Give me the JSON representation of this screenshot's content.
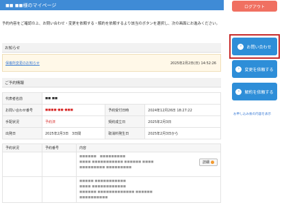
{
  "header": {
    "title": "◼◼ ◼◼様のマイページ"
  },
  "intro": "予約内容をご確認の上、お問い合わせ・変更を依頼する・解約を依頼するより該当のボタンを選択し、次の画面にお進みください。",
  "notice": {
    "heading": "お知らせ",
    "link": "保養所変更のお知らせ",
    "date": "2025年2月2日(日) 14:52:26"
  },
  "reservation": {
    "heading": "ご予約情報",
    "rows": [
      {
        "k1": "代表者名前",
        "v1": "◼◼ ◼◼",
        "k2": "",
        "v2": ""
      },
      {
        "k1": "お問い合わせ番号",
        "v1": "◼◼◼◼-◼◼-◼◼◼",
        "k2": "予約受付日時",
        "v2": "2024年12月26日 18:27:22"
      },
      {
        "k1": "手配状況",
        "v1": "予約済",
        "k2": "契約成立日",
        "v2": "2025年2月3日"
      },
      {
        "k1": "出発日",
        "v1": "2025年2月3日　3日間",
        "k2": "取消料発生日",
        "v2": "2025年2月3日から"
      }
    ],
    "detail_headers": [
      "予約状況",
      "予約番号",
      "内容"
    ],
    "detail_lines_1": [
      "◼◼◼◼◼◼　◼◼◼◼◼◼◼◼◼",
      "◼◼◼◼ ◼◼◼◼◼◼◼◼◼◼◼ ◼◼◼◼◼◼ ◼◼◼◼",
      "◼◼◼◼◼◼◼◼◼ ◼◼◼◼◼◼◼◼◼"
    ],
    "detail_lines_2": [
      "◼◼◼◼◼ ◼◼◼◼◼◼◼◼◼◼◼",
      "◼◼◼◼ ◼◼◼◼◼◼◼◼◼◼◼◼",
      "◼◼◼◼◼◼ ◼◼◼◼◼◼◼◼◼◼◼◼◼ ◼◼◼◼◼◼",
      "◼◼◼◼◼◼◼◼◼◼"
    ],
    "detail_button": "詳細"
  },
  "sidebar": {
    "logout": "ログアウト",
    "inquiry": "お問い合わせ",
    "change": "変更を依頼する",
    "cancel": "解約を依頼する",
    "history_link": "お申し込み後の内容を表示"
  }
}
